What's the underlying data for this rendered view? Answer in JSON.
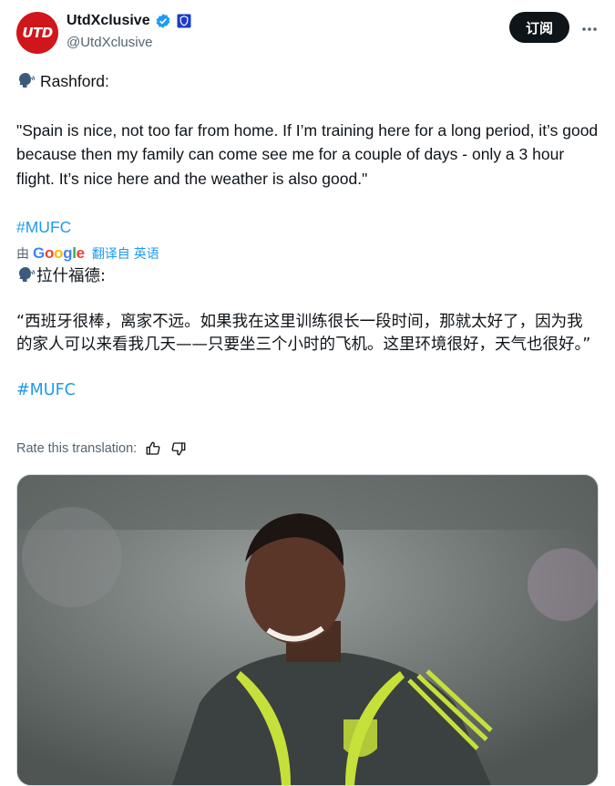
{
  "author": {
    "display_name": "UtdXclusive",
    "handle": "@UtdXclusive",
    "avatar_text": "UTD"
  },
  "header": {
    "subscribe_label": "订阅"
  },
  "tweet": {
    "speaker": "Rashford:",
    "quote": "\"Spain is nice, not too far from home. If I’m training here for a long period, it’s good because then my family can come see me for a couple of days - only a 3 hour flight. It’s nice here and the weather is also good.\"",
    "hashtag": "#MUFC"
  },
  "translation": {
    "by_label": "由",
    "provider_letters": [
      "G",
      "o",
      "o",
      "g",
      "l",
      "e"
    ],
    "from_label": "翻译自 英语",
    "speaker": "拉什福德:",
    "quote": "“西班牙很棒，离家不远。如果我在这里训练很长一段时间，那就太好了，因为我的家人可以来看我几天——只要坐三个小时的飞机。这里环境很好，天气也很好。”",
    "hashtag": "#MUFC"
  },
  "rate": {
    "label": "Rate this translation:"
  },
  "icons": {
    "verified": "verified-badge-icon",
    "shield": "shield-icon",
    "more": "more-icon",
    "speak": "speaking-head-icon",
    "thumb_up": "thumb-up-icon",
    "thumb_down": "thumb-down-icon"
  },
  "colors": {
    "accent": "#1d9bf0",
    "avatar_bg": "#d0151b",
    "button_bg": "#0f1419",
    "muted": "#536471",
    "kit_trim": "#c6e03a"
  }
}
